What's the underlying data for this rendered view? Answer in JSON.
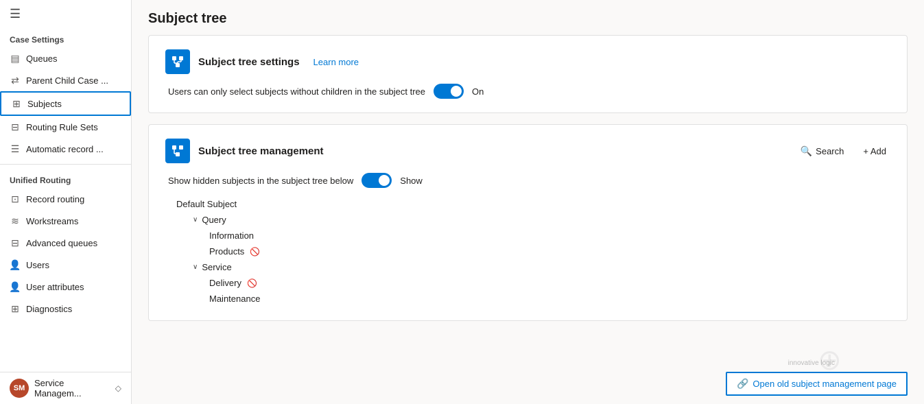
{
  "sidebar": {
    "hamburger_icon": "☰",
    "sections": [
      {
        "label": "Case Settings",
        "items": [
          {
            "id": "queues",
            "label": "Queues",
            "icon": "▤"
          },
          {
            "id": "parent-child-case",
            "label": "Parent Child Case ...",
            "icon": "⇄"
          },
          {
            "id": "subjects",
            "label": "Subjects",
            "icon": "⊞",
            "active": true
          },
          {
            "id": "routing-rule-sets",
            "label": "Routing Rule Sets",
            "icon": "⊟"
          },
          {
            "id": "automatic-record",
            "label": "Automatic record ...",
            "icon": "☰"
          }
        ]
      },
      {
        "label": "Unified Routing",
        "items": [
          {
            "id": "record-routing",
            "label": "Record routing",
            "icon": "⊡"
          },
          {
            "id": "workstreams",
            "label": "Workstreams",
            "icon": "≋"
          },
          {
            "id": "advanced-queues",
            "label": "Advanced queues",
            "icon": "⊟"
          },
          {
            "id": "users",
            "label": "Users",
            "icon": "👤"
          },
          {
            "id": "user-attributes",
            "label": "User attributes",
            "icon": "👤"
          },
          {
            "id": "diagnostics",
            "label": "Diagnostics",
            "icon": "⊞"
          }
        ]
      }
    ],
    "bottom": {
      "avatar_initials": "SM",
      "label": "Service Managem...",
      "icon": "◇"
    }
  },
  "main": {
    "title": "Subject tree",
    "card1": {
      "icon": "🌳",
      "title": "Subject tree settings",
      "learn_more": "Learn more",
      "toggle1": {
        "label": "Users can only select subjects without children in the subject tree",
        "state_label": "On",
        "enabled": true
      }
    },
    "card2": {
      "icon": "⊞",
      "title": "Subject tree management",
      "toggle2": {
        "label": "Show hidden subjects in the subject tree below",
        "state_label": "Show",
        "enabled": true
      },
      "search_label": "Search",
      "add_label": "+ Add",
      "tree": {
        "root": "Default Subject",
        "branches": [
          {
            "label": "Query",
            "expanded": true,
            "children": [
              {
                "label": "Information",
                "hidden": false
              },
              {
                "label": "Products",
                "hidden": true
              }
            ]
          },
          {
            "label": "Service",
            "expanded": true,
            "children": [
              {
                "label": "Delivery",
                "hidden": true
              },
              {
                "label": "Maintenance",
                "hidden": false
              }
            ]
          }
        ]
      }
    },
    "open_old_btn": "Open old subject management page",
    "innovative_logic": "innovative logic"
  }
}
